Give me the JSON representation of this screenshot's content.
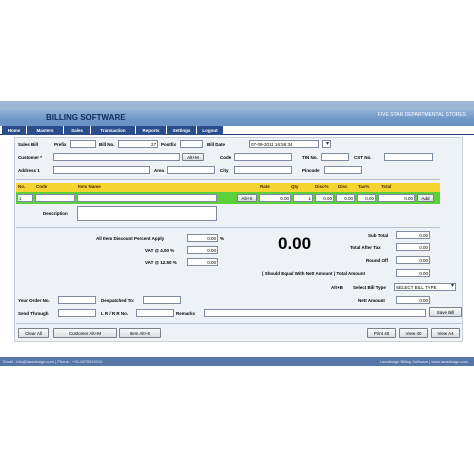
{
  "window": {
    "title": "BILLING SOFTWARE",
    "store": "FIVE STAR DEPARTMENTAL STORES"
  },
  "menu": [
    "Home",
    "Masters",
    "Sales",
    "Transaction",
    "Reports",
    "Settings",
    "Logout"
  ],
  "form": {
    "sales_bill": "Sales Bill",
    "prefix": "Prefix",
    "bill_no": "Bill No.",
    "bill_no_value": "27",
    "postfix": "Postfix",
    "bill_date": "Bill Date",
    "bill_date_value": "07-09-2011 16:56:34",
    "customer": "Customer *",
    "alt_m": "Alt+M",
    "code": "Code",
    "tin_no": "TIN No.",
    "cst_no": "CST No.",
    "address1": "Address 1",
    "area": "Area",
    "city": "City",
    "pincode": "Pincode"
  },
  "items_header": [
    "No.",
    "Code",
    "Item Name",
    "Rate",
    "Qty",
    "Disc%",
    "Disc",
    "Tax%",
    "Total"
  ],
  "item_row": {
    "no": "1",
    "alt_s": "Alt+S",
    "rate": "0.00",
    "qty": "1",
    "disc_pct": "0.00",
    "disc": "0.00",
    "tax_pct": "0.00",
    "total": "0.00",
    "add": "Add"
  },
  "description_label": "Description",
  "totals_left": {
    "all_disc_label": "All Item Discount Percent Apply",
    "all_disc_value": "0.00",
    "pct": "%",
    "vat4_label": "VAT @ 4.00 %",
    "vat4_value": "0.00",
    "vat125_label": "VAT @ 12.50 %",
    "vat125_value": "0.00"
  },
  "grand_total": "0.00",
  "totals_right": {
    "sub_total_label": "Sub Total",
    "sub_total": "0.00",
    "total_after_tax_label": "Total After Tax",
    "total_after_tax": "0.00",
    "round_off_label": "Round Off",
    "round_off": "0.00",
    "equal_note": "( Should Equal With Nett Amount ) Total Amount",
    "total_amount": "0.00",
    "alt_b": "Alt+B",
    "bill_type_label": "Select Bill Type",
    "bill_type_value": "SELECT BILL TYPE",
    "nett_label": "Nett Amount",
    "nett": "0.00"
  },
  "bottom_fields": {
    "your_order": "Your Order No.",
    "despatched": "Despatched To:",
    "send_through": "Send Through",
    "lr_rr": "L R / R R No.",
    "remarks": "Remarks",
    "save_bill": "Save Bill"
  },
  "actions": {
    "clear_all": "Clear All",
    "customer_altm": "Customer Alt+M",
    "item_alts": "Item Alt+S",
    "print40": "Print 40",
    "view40": "View 40",
    "viewa4": "View A4"
  },
  "footer": {
    "left": "Email : info@laradesign.com | Phone : +91-9876543210",
    "right": "Laradesign Billing Software | www.laradesign.com"
  }
}
